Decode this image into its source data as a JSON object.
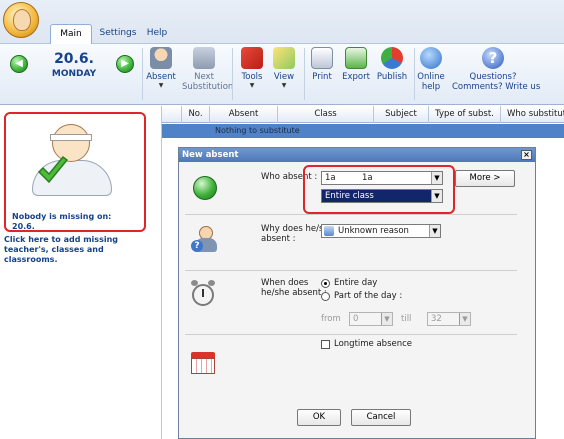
{
  "ribbon": {
    "tabs": [
      "Main",
      "Settings",
      "Help"
    ],
    "active_tab": "Main",
    "date": "20.6.",
    "weekday": "MONDAY",
    "buttons": {
      "absent": "Absent",
      "next_substitution_1": "Next",
      "next_substitution_2": "Substitution",
      "tools": "Tools",
      "view": "View",
      "print": "Print",
      "export": "Export",
      "publish": "Publish",
      "online_help_1": "Online",
      "online_help_2": "help",
      "questions_1": "Questions?",
      "questions_2": "Comments? Write us"
    }
  },
  "left_panel": {
    "missing_title": "Nobody is missing on:",
    "missing_date": "20.6.",
    "add_link": "Click here to add missing teacher's, classes and classrooms."
  },
  "grid": {
    "columns": [
      "No.",
      "Absent",
      "Class",
      "Subject",
      "Type of subst.",
      "Who substitutes"
    ],
    "selected_row_text": "Nothing to substitute"
  },
  "dialog": {
    "title": "New absent",
    "who_absent_label": "Who absent :",
    "class_combo_left": "1a",
    "class_combo_right": "1a",
    "scope_combo": "Entire class",
    "more_button": "More >",
    "why_label_1": "Why does he/she",
    "why_label_2": "absent :",
    "reason_combo": "Unknown reason",
    "when_label_1": "When does",
    "when_label_2": "he/she absent :",
    "radio_entire_day": "Entire day",
    "radio_part_of_day": "Part of the day :",
    "from_label": "from",
    "from_value": "0",
    "till_label": "till",
    "till_value": "32",
    "longtime_label": "Longtime absence",
    "ok_button": "OK",
    "cancel_button": "Cancel"
  },
  "colors": {
    "accent_blue": "#15428b",
    "highlight_red": "#e0242a",
    "selection_navy": "#12266a"
  }
}
